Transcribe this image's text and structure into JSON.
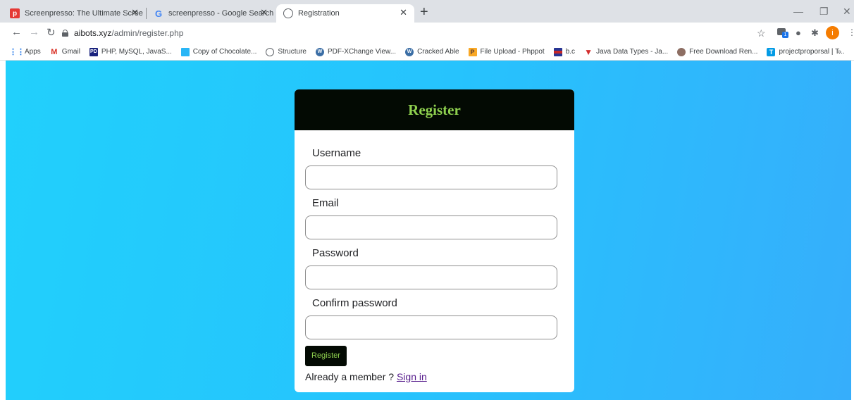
{
  "browser": {
    "tabs": [
      {
        "title": "Screenpresso: The Ultimate Scree",
        "icon": "screenpresso-icon"
      },
      {
        "title": "screenpresso - Google Search",
        "icon": "google-icon"
      },
      {
        "title": "Registration",
        "icon": "globe-icon"
      }
    ],
    "address": {
      "domain": "aibots.xyz",
      "path": "/admin/register.php"
    },
    "profile_initial": "i",
    "extension_badge": "1",
    "bookmarks": [
      {
        "label": "Apps",
        "icon": "apps-icon"
      },
      {
        "label": "Gmail",
        "icon": "gmail-icon"
      },
      {
        "label": "PHP, MySQL, JavaS...",
        "icon": "pd-icon",
        "icon_text": "PD"
      },
      {
        "label": "Copy of Chocolate...",
        "icon": "sheet-icon"
      },
      {
        "label": "Structure",
        "icon": "globe-icon"
      },
      {
        "label": "PDF-XChange View...",
        "icon": "wordpress-icon"
      },
      {
        "label": "Cracked Able",
        "icon": "wordpress-icon"
      },
      {
        "label": "File Upload - Phppot",
        "icon": "phppot-icon"
      },
      {
        "label": "b.c",
        "icon": "flag-icon"
      },
      {
        "label": "Java Data Types - Ja...",
        "icon": "vv-icon"
      },
      {
        "label": "Free Download Ren...",
        "icon": "download-icon"
      },
      {
        "label": "projectproporsal | T...",
        "icon": "t-icon"
      }
    ],
    "bookmarks_more": "»"
  },
  "form": {
    "title": "Register",
    "fields": [
      {
        "label": "Username",
        "value": "",
        "type": "text"
      },
      {
        "label": "Email",
        "value": "",
        "type": "email"
      },
      {
        "label": "Password",
        "value": "",
        "type": "password"
      },
      {
        "label": "Confirm password",
        "value": "",
        "type": "password"
      }
    ],
    "submit_label": "Register",
    "member_text": "Already a member ? ",
    "signin_label": "Sign in"
  },
  "colors": {
    "header_bg": "#030a03",
    "accent_green": "#8fd14f",
    "page_gradient_start": "#21d0fc",
    "page_gradient_end": "#36aefb",
    "link": "#551a8b"
  }
}
